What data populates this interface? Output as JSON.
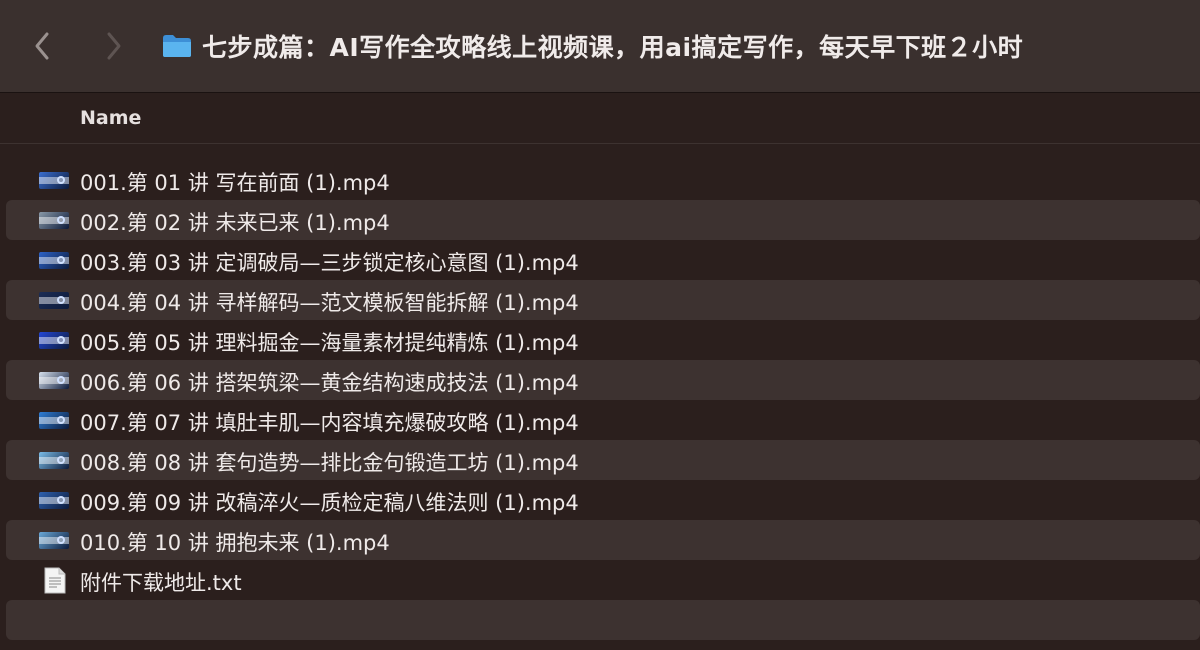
{
  "window": {
    "title": "七步成篇：AI写作全攻略线上视频课，用ai搞定写作，每天早下班２小时"
  },
  "toolbar": {
    "back_icon": "chevron-left-icon",
    "forward_icon": "chevron-right-icon",
    "folder_icon": "folder-icon",
    "accent": "#4aa8e8"
  },
  "list_header": {
    "name": "Name"
  },
  "files": [
    {
      "name": "001.第 01 讲 写在前面 (1).mp4",
      "kind": "video",
      "thumb": "#3b6fd1"
    },
    {
      "name": "002.第 02 讲 未来已来 (1).mp4",
      "kind": "video",
      "thumb": "#8a9aa8"
    },
    {
      "name": "003.第 03 讲 定调破局—三步锁定核心意图 (1).mp4",
      "kind": "video",
      "thumb": "#2d63c8"
    },
    {
      "name": "004.第 04 讲 寻样解码—范文模板智能拆解 (1).mp4",
      "kind": "video",
      "thumb": "#1c2d55"
    },
    {
      "name": "005.第 05 讲 理料掘金—海量素材提纯精炼 (1).mp4",
      "kind": "video",
      "thumb": "#2448d6"
    },
    {
      "name": "006.第 06 讲 搭架筑梁—黄金结构速成技法 (1).mp4",
      "kind": "video",
      "thumb": "#d8e2ee"
    },
    {
      "name": "007.第 07 讲 填肚丰肌—内容填充爆破攻略 (1).mp4",
      "kind": "video",
      "thumb": "#2f7fd6"
    },
    {
      "name": "008.第 08 讲 套句造势—排比金句锻造工坊 (1).mp4",
      "kind": "video",
      "thumb": "#7bbde8"
    },
    {
      "name": "009.第 09 讲 改稿淬火—质检定稿八维法则 (1).mp4",
      "kind": "video",
      "thumb": "#2f62b0"
    },
    {
      "name": "010.第 10 讲 拥抱未来 (1).mp4",
      "kind": "video",
      "thumb": "#6aa9d8"
    },
    {
      "name": "附件下载地址.txt",
      "kind": "text",
      "thumb": "#ffffff"
    }
  ]
}
